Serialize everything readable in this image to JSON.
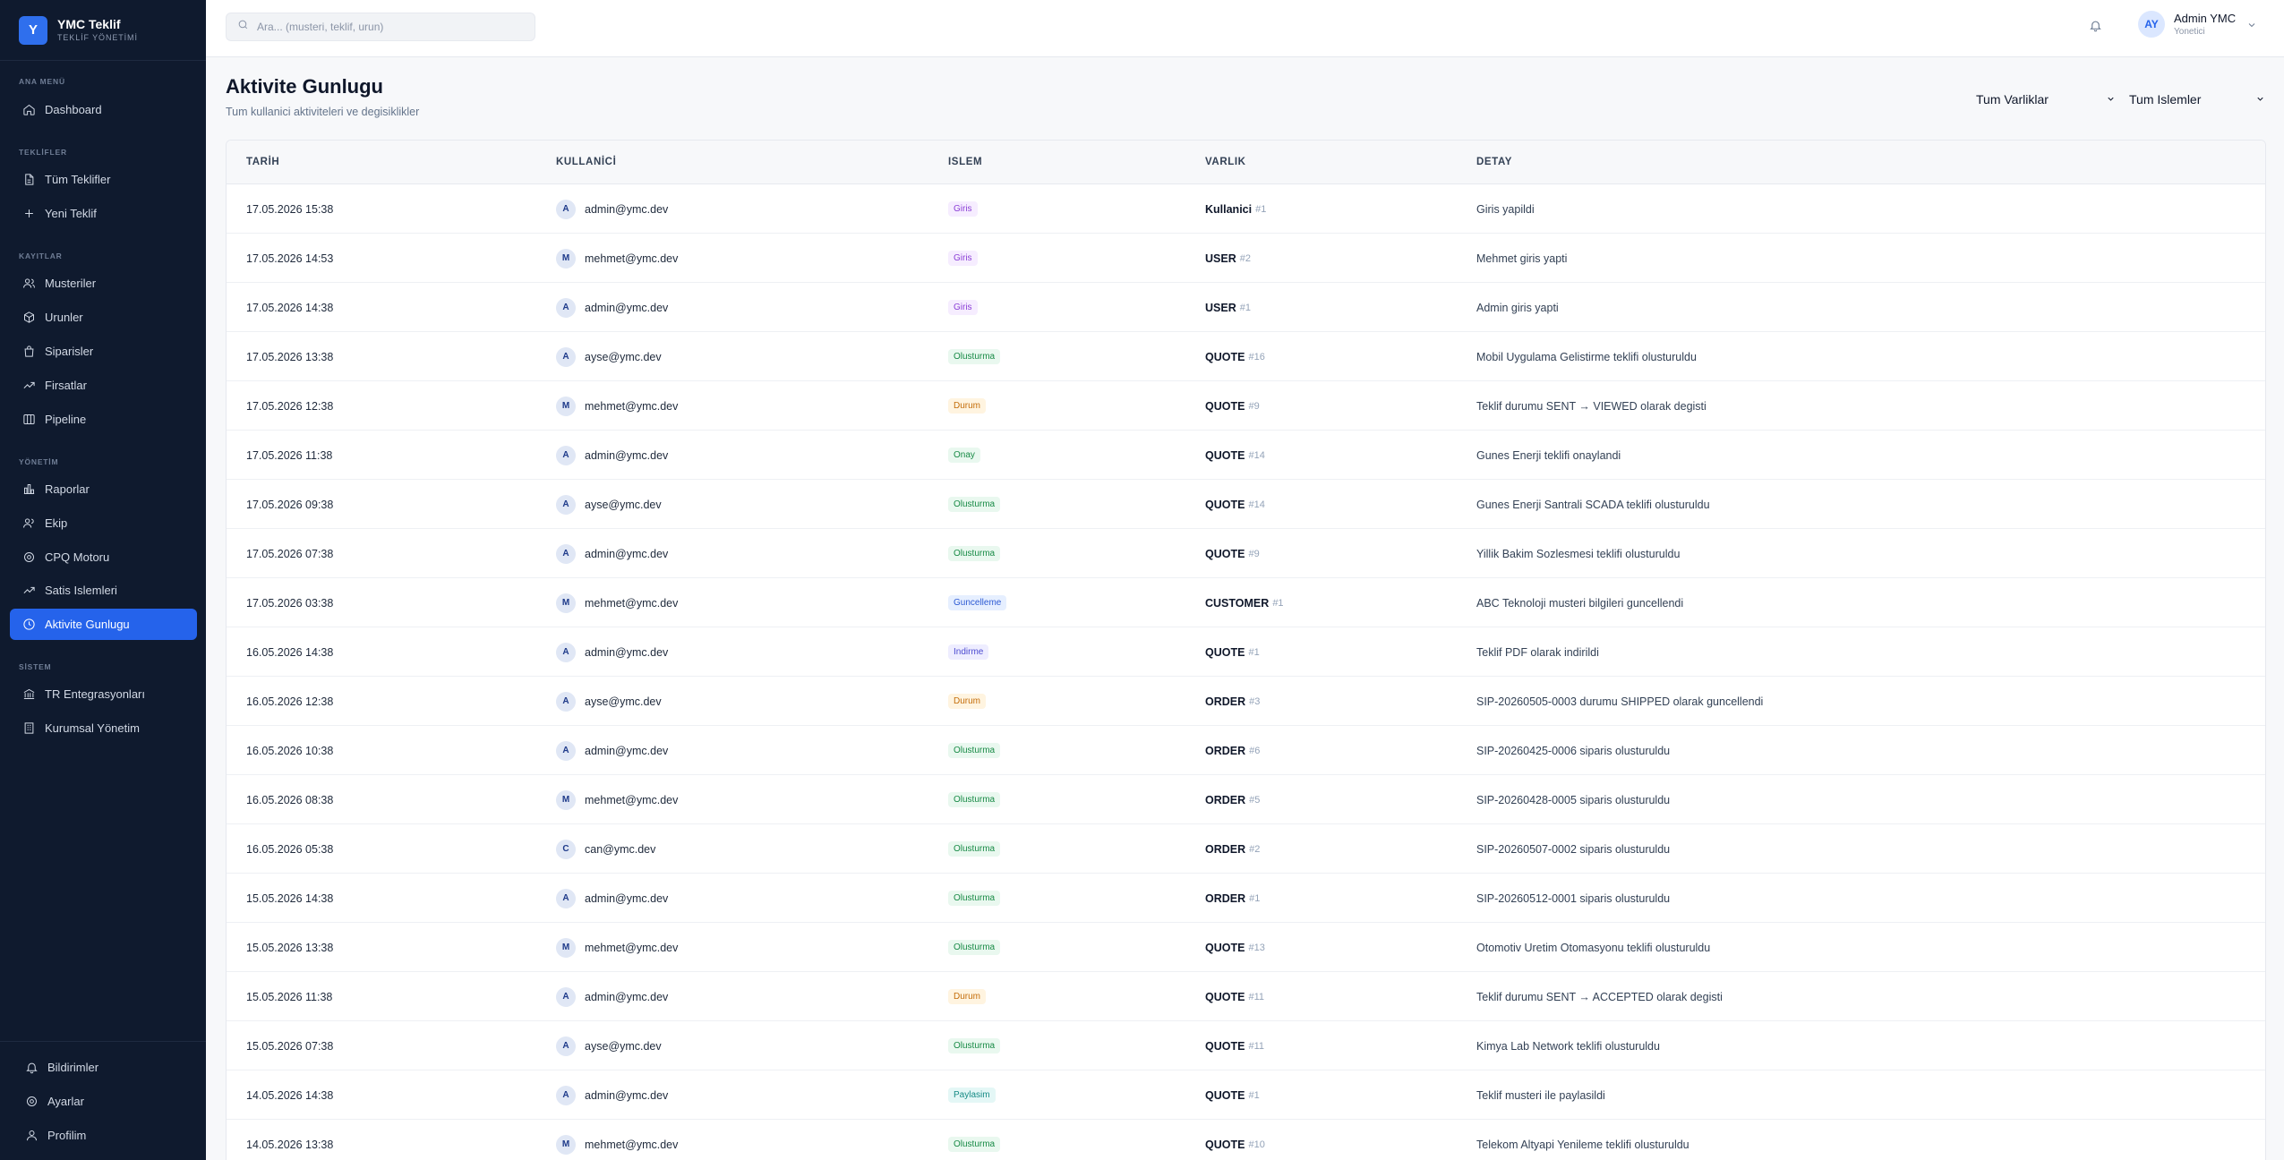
{
  "brand": {
    "logo": "Y",
    "title": "YMC Teklif",
    "subtitle": "TEKLİF YÖNETİMİ"
  },
  "sidebar": {
    "sections": {
      "ana_menu": "ANA MENÜ",
      "teklifler": "TEKLİFLER",
      "kayitlar": "KAYITLAR",
      "yonetim": "YÖNETİM",
      "sistem": "SİSTEM"
    },
    "items": {
      "dashboard": "Dashboard",
      "tum_teklifler": "Tüm Teklifler",
      "yeni_teklif": "Yeni Teklif",
      "musteriler": "Musteriler",
      "urunler": "Urunler",
      "siparisler": "Siparisler",
      "firsatlar": "Firsatlar",
      "pipeline": "Pipeline",
      "raporlar": "Raporlar",
      "ekip": "Ekip",
      "cpq": "CPQ Motoru",
      "satis": "Satis Islemleri",
      "aktivite": "Aktivite Gunlugu",
      "tr_entegrasyon": "TR Entegrasyonları",
      "kurumsal": "Kurumsal Yönetim"
    },
    "bottom": {
      "bildirimler": "Bildirimler",
      "ayarlar": "Ayarlar",
      "profilim": "Profilim"
    }
  },
  "topbar": {
    "search_placeholder": "Ara... (musteri, teklif, urun)",
    "user_initials": "AY",
    "user_name": "Admin YMC",
    "user_role": "Yonetici"
  },
  "page": {
    "title": "Aktivite Gunlugu",
    "subtitle": "Tum kullanici aktiviteleri ve degisiklikler",
    "filter_entities": "Tum Varliklar",
    "filter_actions": "Tum Islemler"
  },
  "table": {
    "headers": {
      "date": "TARİH",
      "user": "KULLANİCİ",
      "action": "ISLEM",
      "entity": "VARLIK",
      "detail": "DETAY"
    },
    "rows": [
      {
        "date": "17.05.2026 15:38",
        "initial": "A",
        "user": "admin@ymc.dev",
        "action": "Giris",
        "type": "giris",
        "entity": "Kullanici",
        "id": "#1",
        "detail": "Giris yapildi"
      },
      {
        "date": "17.05.2026 14:53",
        "initial": "M",
        "user": "mehmet@ymc.dev",
        "action": "Giris",
        "type": "giris",
        "entity": "USER",
        "id": "#2",
        "detail": "Mehmet giris yapti"
      },
      {
        "date": "17.05.2026 14:38",
        "initial": "A",
        "user": "admin@ymc.dev",
        "action": "Giris",
        "type": "giris",
        "entity": "USER",
        "id": "#1",
        "detail": "Admin giris yapti"
      },
      {
        "date": "17.05.2026 13:38",
        "initial": "A",
        "user": "ayse@ymc.dev",
        "action": "Olusturma",
        "type": "olusturma",
        "entity": "QUOTE",
        "id": "#16",
        "detail": "Mobil Uygulama Gelistirme teklifi olusturuldu"
      },
      {
        "date": "17.05.2026 12:38",
        "initial": "M",
        "user": "mehmet@ymc.dev",
        "action": "Durum",
        "type": "durum",
        "entity": "QUOTE",
        "id": "#9",
        "detail": "Teklif durumu SENT → VIEWED olarak degisti"
      },
      {
        "date": "17.05.2026 11:38",
        "initial": "A",
        "user": "admin@ymc.dev",
        "action": "Onay",
        "type": "onay",
        "entity": "QUOTE",
        "id": "#14",
        "detail": "Gunes Enerji teklifi onaylandi"
      },
      {
        "date": "17.05.2026 09:38",
        "initial": "A",
        "user": "ayse@ymc.dev",
        "action": "Olusturma",
        "type": "olusturma",
        "entity": "QUOTE",
        "id": "#14",
        "detail": "Gunes Enerji Santrali SCADA teklifi olusturuldu"
      },
      {
        "date": "17.05.2026 07:38",
        "initial": "A",
        "user": "admin@ymc.dev",
        "action": "Olusturma",
        "type": "olusturma",
        "entity": "QUOTE",
        "id": "#9",
        "detail": "Yillik Bakim Sozlesmesi teklifi olusturuldu"
      },
      {
        "date": "17.05.2026 03:38",
        "initial": "M",
        "user": "mehmet@ymc.dev",
        "action": "Guncelleme",
        "type": "guncelleme",
        "entity": "CUSTOMER",
        "id": "#1",
        "detail": "ABC Teknoloji musteri bilgileri guncellendi"
      },
      {
        "date": "16.05.2026 14:38",
        "initial": "A",
        "user": "admin@ymc.dev",
        "action": "Indirme",
        "type": "indirme",
        "entity": "QUOTE",
        "id": "#1",
        "detail": "Teklif PDF olarak indirildi"
      },
      {
        "date": "16.05.2026 12:38",
        "initial": "A",
        "user": "ayse@ymc.dev",
        "action": "Durum",
        "type": "durum",
        "entity": "ORDER",
        "id": "#3",
        "detail": "SIP-20260505-0003 durumu SHIPPED olarak guncellendi"
      },
      {
        "date": "16.05.2026 10:38",
        "initial": "A",
        "user": "admin@ymc.dev",
        "action": "Olusturma",
        "type": "olusturma",
        "entity": "ORDER",
        "id": "#6",
        "detail": "SIP-20260425-0006 siparis olusturuldu"
      },
      {
        "date": "16.05.2026 08:38",
        "initial": "M",
        "user": "mehmet@ymc.dev",
        "action": "Olusturma",
        "type": "olusturma",
        "entity": "ORDER",
        "id": "#5",
        "detail": "SIP-20260428-0005 siparis olusturuldu"
      },
      {
        "date": "16.05.2026 05:38",
        "initial": "C",
        "user": "can@ymc.dev",
        "action": "Olusturma",
        "type": "olusturma",
        "entity": "ORDER",
        "id": "#2",
        "detail": "SIP-20260507-0002 siparis olusturuldu"
      },
      {
        "date": "15.05.2026 14:38",
        "initial": "A",
        "user": "admin@ymc.dev",
        "action": "Olusturma",
        "type": "olusturma",
        "entity": "ORDER",
        "id": "#1",
        "detail": "SIP-20260512-0001 siparis olusturuldu"
      },
      {
        "date": "15.05.2026 13:38",
        "initial": "M",
        "user": "mehmet@ymc.dev",
        "action": "Olusturma",
        "type": "olusturma",
        "entity": "QUOTE",
        "id": "#13",
        "detail": "Otomotiv Uretim Otomasyonu teklifi olusturuldu"
      },
      {
        "date": "15.05.2026 11:38",
        "initial": "A",
        "user": "admin@ymc.dev",
        "action": "Durum",
        "type": "durum",
        "entity": "QUOTE",
        "id": "#11",
        "detail": "Teklif durumu SENT → ACCEPTED olarak degisti"
      },
      {
        "date": "15.05.2026 07:38",
        "initial": "A",
        "user": "ayse@ymc.dev",
        "action": "Olusturma",
        "type": "olusturma",
        "entity": "QUOTE",
        "id": "#11",
        "detail": "Kimya Lab Network teklifi olusturuldu"
      },
      {
        "date": "14.05.2026 14:38",
        "initial": "A",
        "user": "admin@ymc.dev",
        "action": "Paylasim",
        "type": "paylasim",
        "entity": "QUOTE",
        "id": "#1",
        "detail": "Teklif musteri ile paylasildi"
      },
      {
        "date": "14.05.2026 13:38",
        "initial": "M",
        "user": "mehmet@ymc.dev",
        "action": "Olusturma",
        "type": "olusturma",
        "entity": "QUOTE",
        "id": "#10",
        "detail": "Telekom Altyapi Yenileme teklifi olusturuldu"
      }
    ]
  }
}
